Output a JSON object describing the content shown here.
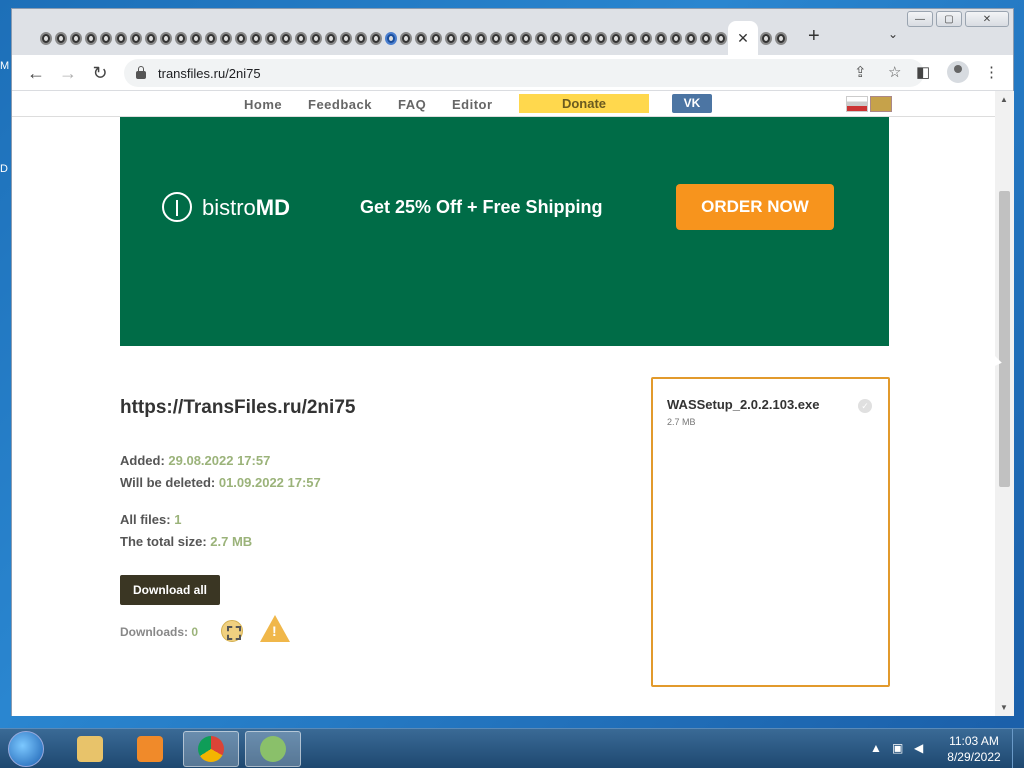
{
  "browser": {
    "tab_close": "✕",
    "new_tab": "+",
    "tab_menu": "⌄",
    "window_controls": {
      "minimize": "—",
      "maximize": "▢",
      "close": "✕"
    },
    "url": "transfiles.ru/2ni75",
    "nav": {
      "back": "←",
      "forward": "→",
      "reload": "↻"
    },
    "toolbar_icons": {
      "share": "⇪",
      "bookmark": "☆",
      "sidepanel": "◧",
      "menu": "⋮"
    }
  },
  "site_nav": {
    "home": "Home",
    "feedback": "Feedback",
    "faq": "FAQ",
    "editor": "Editor",
    "donate": "Donate",
    "vk": "VK"
  },
  "ad": {
    "logo_light": "bistro",
    "logo_bold": "MD",
    "tagline": "Get 25% Off + Free Shipping",
    "cta": "ORDER NOW"
  },
  "page": {
    "link": "https://TransFiles.ru/2ni75",
    "added_label": "Added: ",
    "added_value": "29.08.2022 17:57",
    "deleted_label": "Will be deleted: ",
    "deleted_value": "01.09.2022 17:57",
    "files_label": "All files: ",
    "files_value": "1",
    "size_label": "The total size: ",
    "size_value": "2.7 MB",
    "download_all": "Download all",
    "downloads_label": "Downloads: ",
    "downloads_value": "0"
  },
  "file": {
    "name": "WASSetup_2.0.2.103.exe",
    "size": "2.7 MB"
  },
  "taskbar": {
    "time": "11:03 AM",
    "date": "8/29/2022"
  },
  "colors": {
    "ad_bg": "#006c47",
    "ad_cta": "#f7941d",
    "donate": "#ffd84d",
    "vk": "#4c75a3",
    "value_green": "#9bb37a",
    "file_border": "#e29a2c"
  }
}
